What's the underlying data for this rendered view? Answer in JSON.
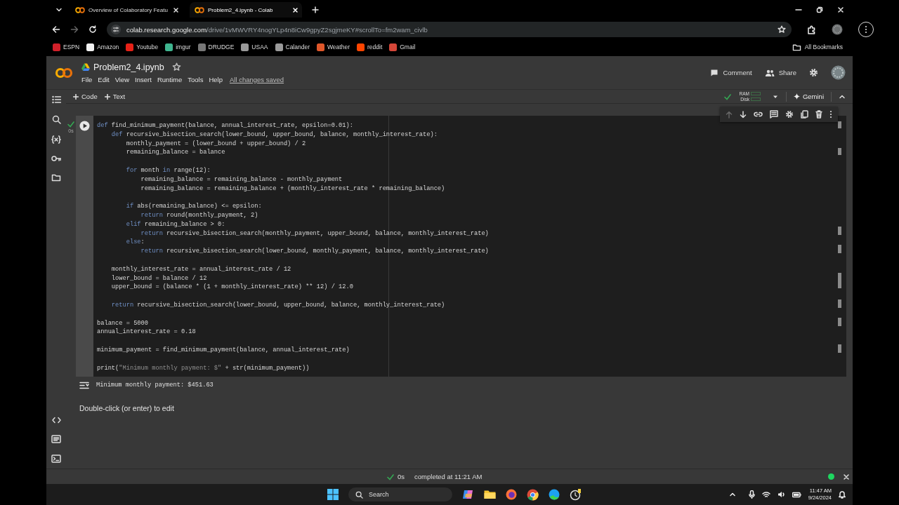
{
  "browser": {
    "tabs": [
      {
        "title": "Overview of Colaboratory Featu",
        "selected": false
      },
      {
        "title": "Problem2_4.ipynb - Colab",
        "selected": true
      }
    ],
    "address": {
      "host": "colab.research.google.com",
      "path": "/drive/1vMWVRY4nogYLp4n8iCw9gpyZ2sgjmeKY#scrollTo=fm2wam_civlb"
    },
    "bookmarks": [
      {
        "label": "ESPN",
        "color": "#d0202a"
      },
      {
        "label": "Amazon",
        "color": "#f2f2f2"
      },
      {
        "label": "Youtube",
        "color": "#e62117"
      },
      {
        "label": "imgur",
        "color": "#3fb58f"
      },
      {
        "label": "DRUDGE",
        "color": "#777777"
      },
      {
        "label": "USAA",
        "color": "#9a9a9a"
      },
      {
        "label": "Calander",
        "color": "#9a9a9a"
      },
      {
        "label": "Weather",
        "color": "#e0572a"
      },
      {
        "label": "reddit",
        "color": "#ff4500"
      },
      {
        "label": "Gmail",
        "color": "#d44638"
      }
    ],
    "all_bookmarks": "All Bookmarks"
  },
  "notebook": {
    "title": "Problem2_4.ipynb",
    "menu": [
      "File",
      "Edit",
      "View",
      "Insert",
      "Runtime",
      "Tools",
      "Help"
    ],
    "save_status": "All changes saved",
    "actions": [
      "Comment",
      "Share"
    ],
    "toolbar": {
      "add": [
        "Code",
        "Text"
      ],
      "ram_label": "RAM",
      "disk_label": "Disk",
      "gemini": "Gemini"
    },
    "cell": {
      "run_time": "0s",
      "move_up_disabled": true,
      "code_blocks": [
        [
          [
            {
              "kind": "keyword",
              "text": "def"
            },
            {
              "kind": "plain",
              "text": " find_minimum_payment(balance, annual_interest_rate, epsilon=0.01):"
            }
          ],
          [
            {
              "kind": "keyword",
              "text": "    def"
            },
            {
              "kind": "plain",
              "text": " recursive_bisection_search(lower_bound, upper_bound, balance, monthly_interest_rate):"
            }
          ],
          [
            {
              "kind": "plain",
              "text": "        monthly_payment = (lower_bound + upper_bound) / 2"
            }
          ],
          [
            {
              "kind": "plain",
              "text": "        remaining_balance = balance"
            }
          ]
        ],
        [
          [
            {
              "kind": "keyword",
              "text": "        for"
            },
            {
              "kind": "plain",
              "text": " month "
            },
            {
              "kind": "keyword",
              "text": "in"
            },
            {
              "kind": "plain",
              "text": " range(12):"
            }
          ],
          [
            {
              "kind": "plain",
              "text": "            remaining_balance = remaining_balance - monthly_payment"
            }
          ],
          [
            {
              "kind": "plain",
              "text": "            remaining_balance = remaining_balance + (monthly_interest_rate * remaining_balance)"
            }
          ]
        ],
        [
          [
            {
              "kind": "keyword",
              "text": "        if"
            },
            {
              "kind": "plain",
              "text": " abs(remaining_balance) <= epsilon:"
            }
          ],
          [
            {
              "kind": "keyword",
              "text": "            return"
            },
            {
              "kind": "plain",
              "text": " round(monthly_payment, 2)"
            }
          ],
          [
            {
              "kind": "keyword",
              "text": "        elif"
            },
            {
              "kind": "plain",
              "text": " remaining_balance > 0:"
            }
          ],
          [
            {
              "kind": "keyword",
              "text": "            return"
            },
            {
              "kind": "plain",
              "text": " recursive_bisection_search(monthly_payment, upper_bound, balance, monthly_interest_rate)"
            }
          ],
          [
            {
              "kind": "keyword",
              "text": "        else"
            },
            {
              "kind": "plain",
              "text": ":"
            }
          ],
          [
            {
              "kind": "keyword",
              "text": "            return"
            },
            {
              "kind": "plain",
              "text": " recursive_bisection_search(lower_bound, monthly_payment, balance, monthly_interest_rate)"
            }
          ]
        ],
        [
          [
            {
              "kind": "plain",
              "text": "    monthly_interest_rate = annual_interest_rate / 12"
            }
          ],
          [
            {
              "kind": "plain",
              "text": "    lower_bound = balance / 12"
            }
          ],
          [
            {
              "kind": "plain",
              "text": "    upper_bound = (balance * (1 + monthly_interest_rate) ** 12) / 12.0"
            }
          ]
        ],
        [
          [
            {
              "kind": "keyword",
              "text": "    return"
            },
            {
              "kind": "plain",
              "text": " recursive_bisection_search(lower_bound, upper_bound, balance, monthly_interest_rate)"
            }
          ]
        ],
        [
          [
            {
              "kind": "plain",
              "text": "balance = 5000"
            }
          ],
          [
            {
              "kind": "plain",
              "text": "annual_interest_rate = 0.18"
            }
          ]
        ],
        [
          [
            {
              "kind": "plain",
              "text": "minimum_payment = find_minimum_payment(balance, annual_interest_rate)"
            }
          ]
        ],
        [
          [
            {
              "kind": "plain",
              "text": "print("
            },
            {
              "kind": "string",
              "text": "\"Minimum monthly payment: $\""
            },
            {
              "kind": "plain",
              "text": " + str(minimum_payment))"
            }
          ]
        ]
      ],
      "output": "Minimum monthly payment: $451.63"
    },
    "text_cell_hint": "Double-click (or enter) to edit",
    "status_bar": {
      "duration": "0s",
      "message": "completed at 11:21 AM"
    }
  },
  "taskbar": {
    "search": "Search",
    "time": "11:47 AM",
    "date": "9/24/2024"
  }
}
